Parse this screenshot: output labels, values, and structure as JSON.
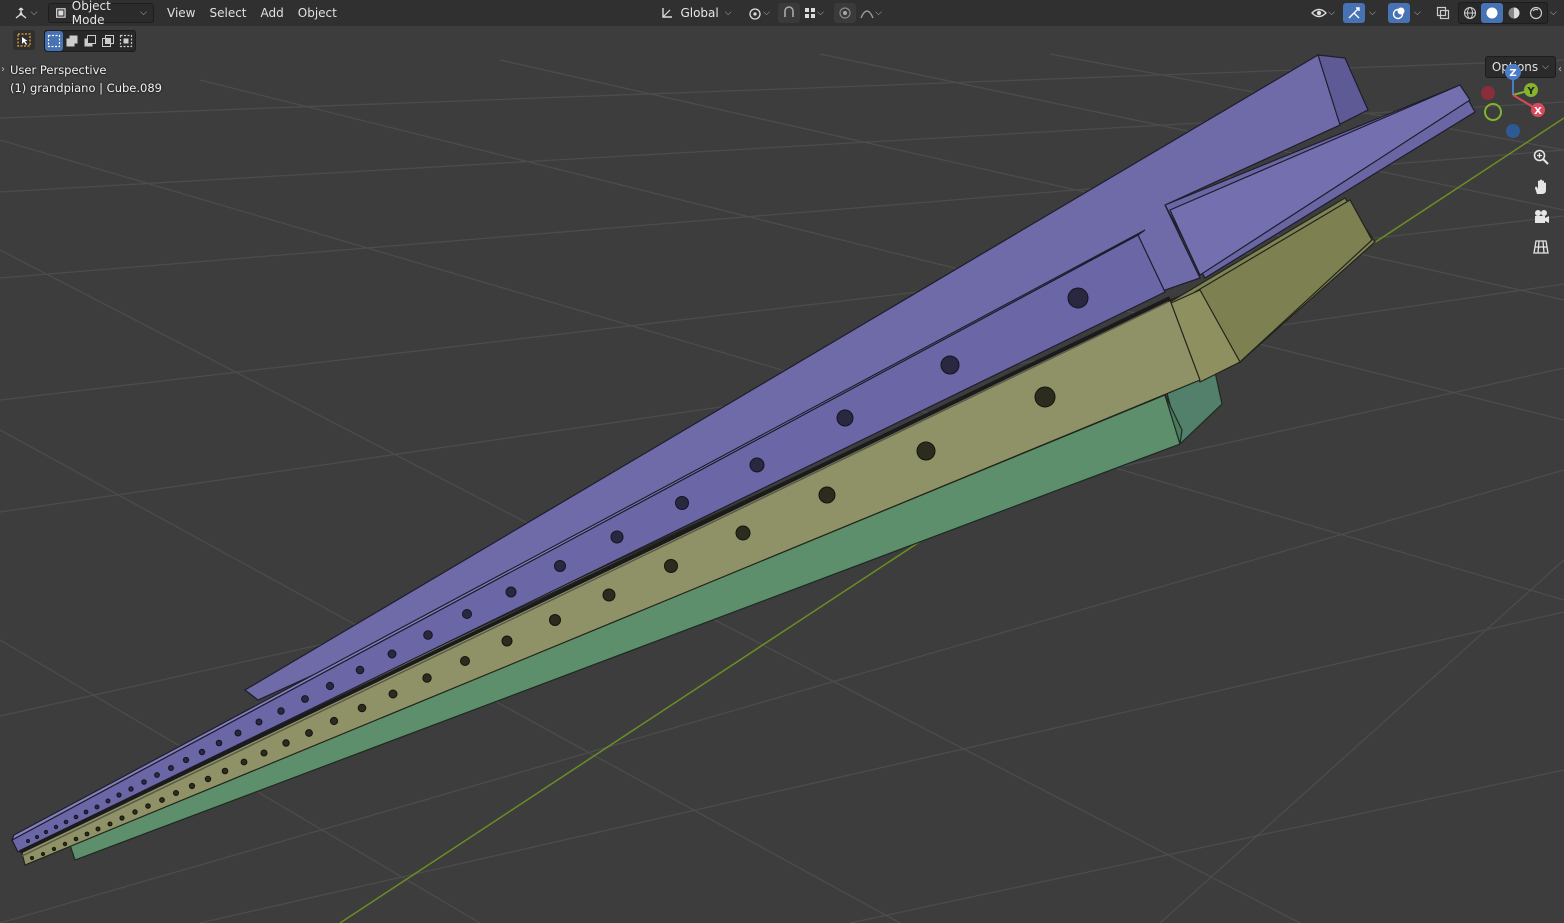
{
  "header": {
    "editor_type_icon": "3d-viewport-icon",
    "mode": {
      "label": "Object Mode",
      "icon": "object-mode-icon"
    },
    "menus": [
      "View",
      "Select",
      "Add",
      "Object"
    ],
    "transform_orientation": {
      "label": "Global",
      "icon": "orientation-icon"
    },
    "pivot_icon": "pivot-point-icon",
    "snap_icon": "snap-icon",
    "snap_target_icon": "snap-increment-icon",
    "proportional_icon": "proportional-editing-icon",
    "falloff_icon": "falloff-curve-icon",
    "visibility_icon": "visibility-icon",
    "gizmo_icon": "gizmo-icon",
    "overlay_icon": "overlay-icon",
    "xray_icon": "xray-icon",
    "shading_modes": [
      "wireframe-shading-icon",
      "solid-shading-icon",
      "material-preview-icon",
      "rendered-shading-icon"
    ],
    "active_shading": "solid-shading-icon"
  },
  "toolbar": {
    "tool_icon": "select-box-tool-icon",
    "selection_modes": [
      "select-new-icon",
      "select-extend-icon",
      "select-subtract-icon",
      "select-intersect-icon",
      "select-invert-icon"
    ],
    "options_label": "Options"
  },
  "viewport": {
    "view_name": "User Perspective",
    "object_info": "(1) grandpiano | Cube.089",
    "gizmo": {
      "z": "Z",
      "y": "Y",
      "x": "X"
    },
    "nav_icons": [
      "zoom-icon",
      "pan-hand-icon",
      "camera-view-icon",
      "ortho-grid-icon"
    ],
    "colors": {
      "background": "#3d3d3d",
      "grid": "#4f4f4f",
      "y_axis": "#6a8e23",
      "purple_object": "#6f6aa8",
      "yellow_object": "#8f9267",
      "green_object": "#5e8f6c"
    }
  }
}
